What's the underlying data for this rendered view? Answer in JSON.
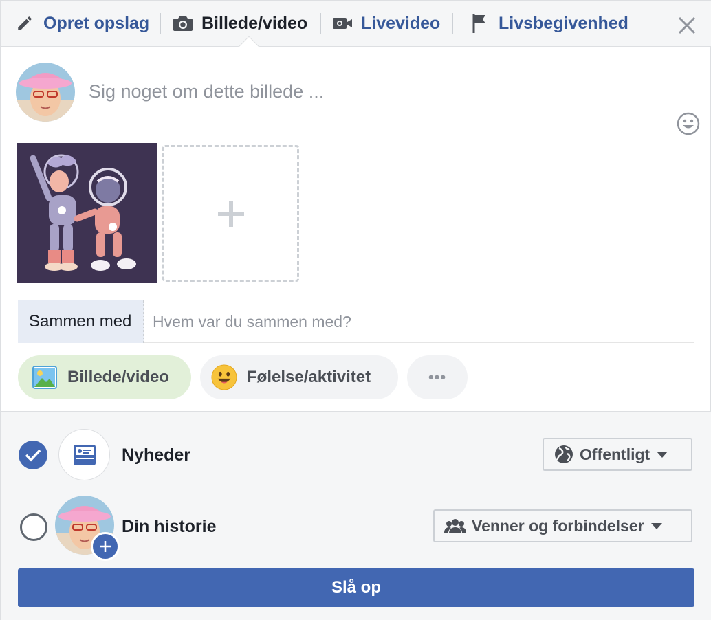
{
  "tabs": [
    {
      "label": "Opret opslag",
      "icon": "pencil-icon"
    },
    {
      "label": "Billede/video",
      "icon": "camera-icon"
    },
    {
      "label": "Livevideo",
      "icon": "video-camera-icon"
    },
    {
      "label": "Livsbegivenhed",
      "icon": "flag-icon"
    }
  ],
  "composer": {
    "placeholder": "Sig noget om dette billede ..."
  },
  "tagging": {
    "label": "Sammen med",
    "placeholder": "Hvem var du sammen med?"
  },
  "actions": [
    {
      "label": "Billede/video",
      "icon": "photo-icon"
    },
    {
      "label": "Følelse/aktivitet",
      "icon": "smiley-icon"
    },
    {
      "label": "•••",
      "icon": "more-icon"
    }
  ],
  "destinations": {
    "news": {
      "label": "Nyheder",
      "checked": true,
      "audience": "Offentligt",
      "audience_icon": "globe-icon"
    },
    "story": {
      "label": "Din historie",
      "checked": false,
      "audience": "Venner og forbindelser",
      "audience_icon": "friends-icon"
    }
  },
  "submit_label": "Slå op",
  "colors": {
    "accent": "#4267b2",
    "link": "#365899",
    "photo_pill_bg": "#e2f0d9",
    "pill_bg": "#f2f3f5"
  }
}
